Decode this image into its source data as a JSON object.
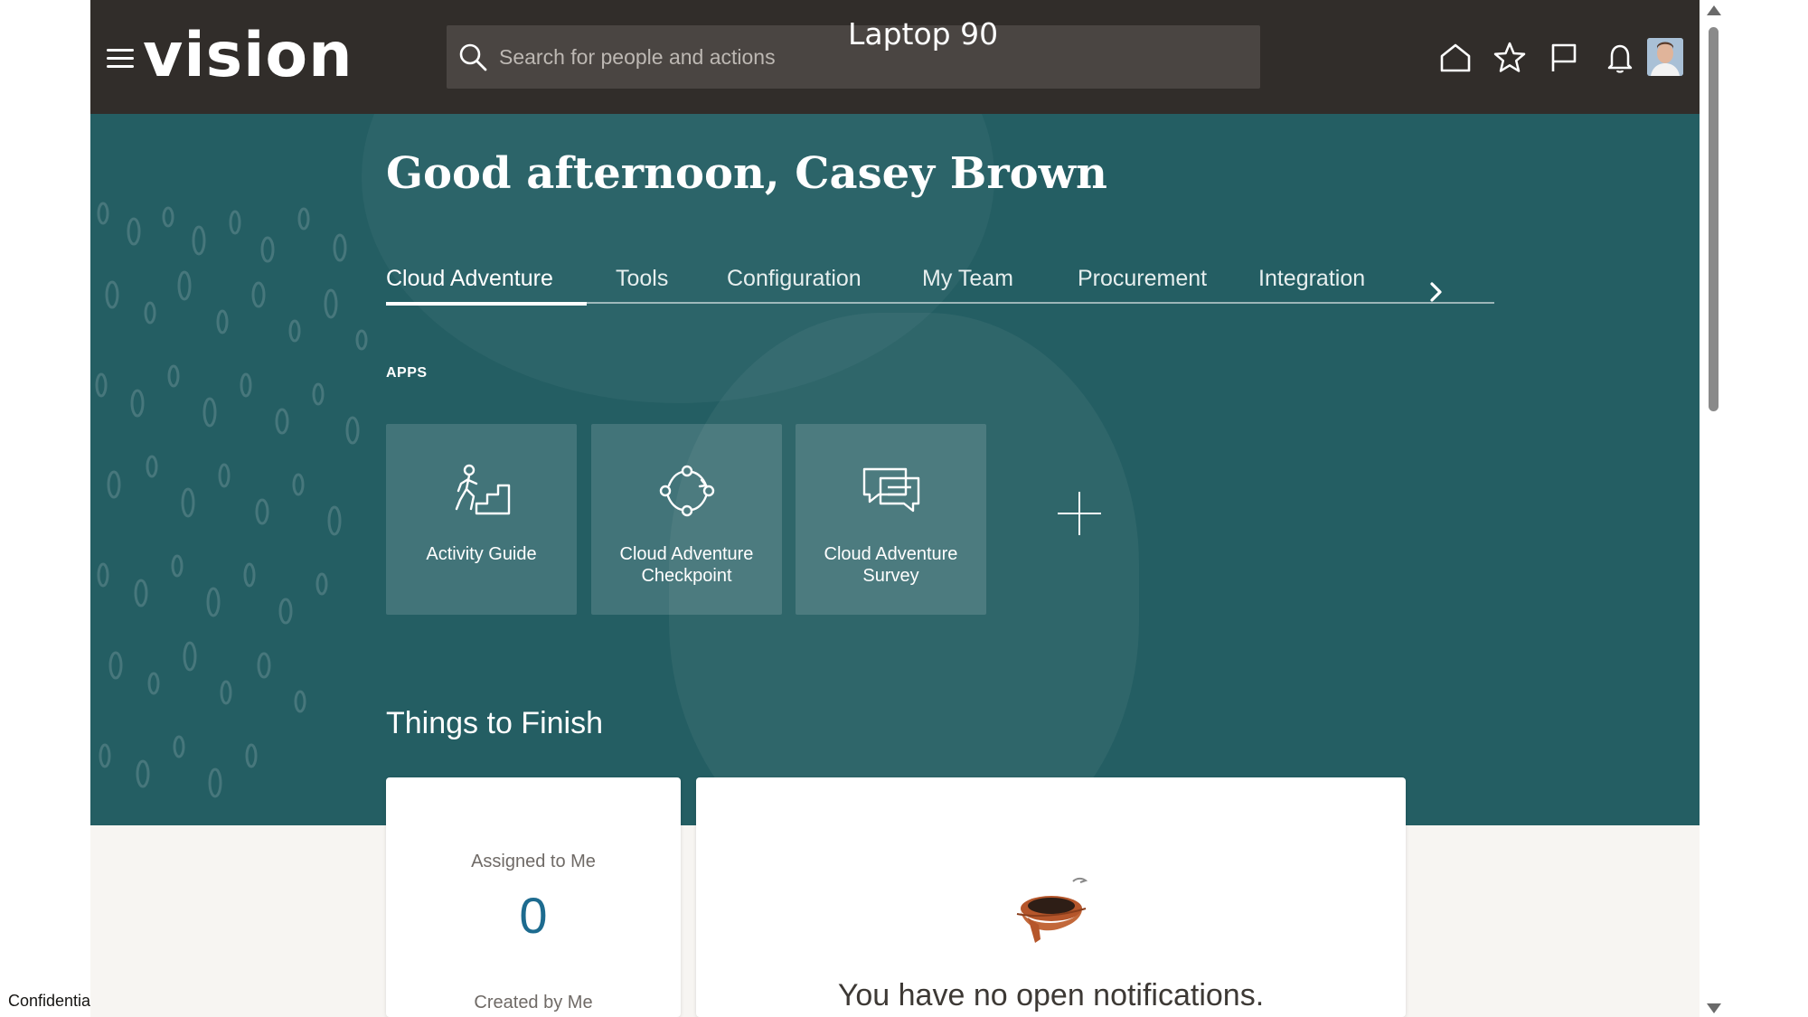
{
  "header": {
    "logo_text": "vision",
    "search_placeholder": "Search for people and actions",
    "overlay_label": "Laptop 90",
    "icons": [
      "menu-icon",
      "search-icon",
      "home-icon",
      "favorites-star-icon",
      "flag-icon",
      "bell-icon",
      "user-avatar"
    ]
  },
  "banner": {
    "greeting": "Good afternoon, Casey Brown",
    "tabs": [
      {
        "label": "Cloud Adventure",
        "active": true
      },
      {
        "label": "Tools"
      },
      {
        "label": "Configuration"
      },
      {
        "label": "My Team"
      },
      {
        "label": "Procurement"
      },
      {
        "label": "Integration"
      }
    ],
    "apps_label": "APPS",
    "apps": [
      {
        "label": "Activity Guide",
        "icon": "activity-guide-icon"
      },
      {
        "label": "Cloud Adventure Checkpoint",
        "icon": "checkpoint-cycle-icon"
      },
      {
        "label": "Cloud Adventure Survey",
        "icon": "survey-chat-icon"
      }
    ],
    "things_to_finish_title": "Things to Finish"
  },
  "tasks": {
    "assigned_label": "Assigned to Me",
    "assigned_count": "0",
    "created_label": "Created by Me"
  },
  "notifications": {
    "empty_message": "You have no open notifications."
  },
  "footer": {
    "confidential_text": "Confidential"
  },
  "colors": {
    "header_bg": "#312d2a",
    "banner_bg": "#245e63",
    "count_accent": "#1d6b8f"
  }
}
